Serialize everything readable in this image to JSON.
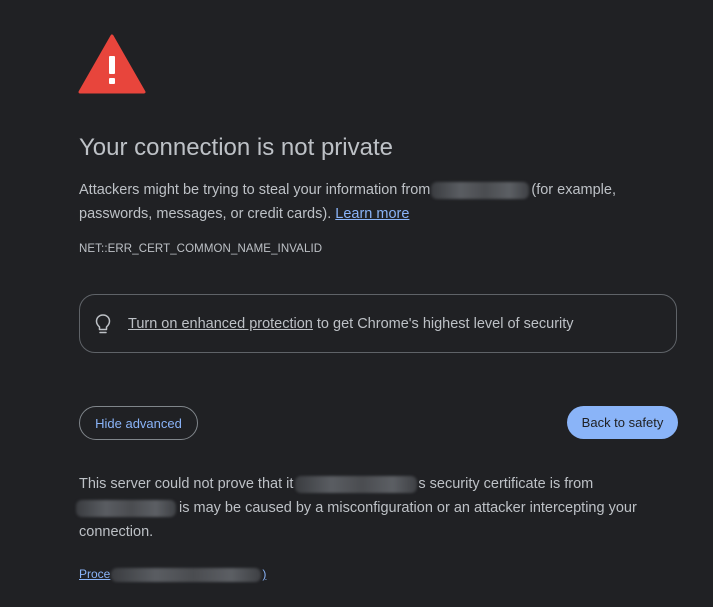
{
  "icons": {
    "warning": "warning-triangle-icon",
    "bulb": "lightbulb-icon"
  },
  "colors": {
    "background": "#202124",
    "text": "#bdc1c6",
    "accent": "#8ab4f8",
    "warning_red": "#e8453c"
  },
  "title": "Your connection is not private",
  "intro": {
    "text_before": "Attackers might be trying to steal your information from",
    "text_after": "(for example, passwords, messages, or credit cards).",
    "learn_more": "Learn more"
  },
  "error_code": "NET::ERR_CERT_COMMON_NAME_INVALID",
  "enhanced_protection": {
    "link": "Turn on enhanced protection",
    "text": "to get Chrome's highest level of security"
  },
  "buttons": {
    "hide_advanced": "Hide advanced",
    "back_to_safety": "Back to safety"
  },
  "details": {
    "part1": "This server could not prove that it",
    "part2": "s security certificate is from",
    "part3": "is may be caused by a misconfiguration or an attacker intercepting your connection."
  },
  "proceed": {
    "link_start": "Proce",
    "link_end": ")"
  }
}
